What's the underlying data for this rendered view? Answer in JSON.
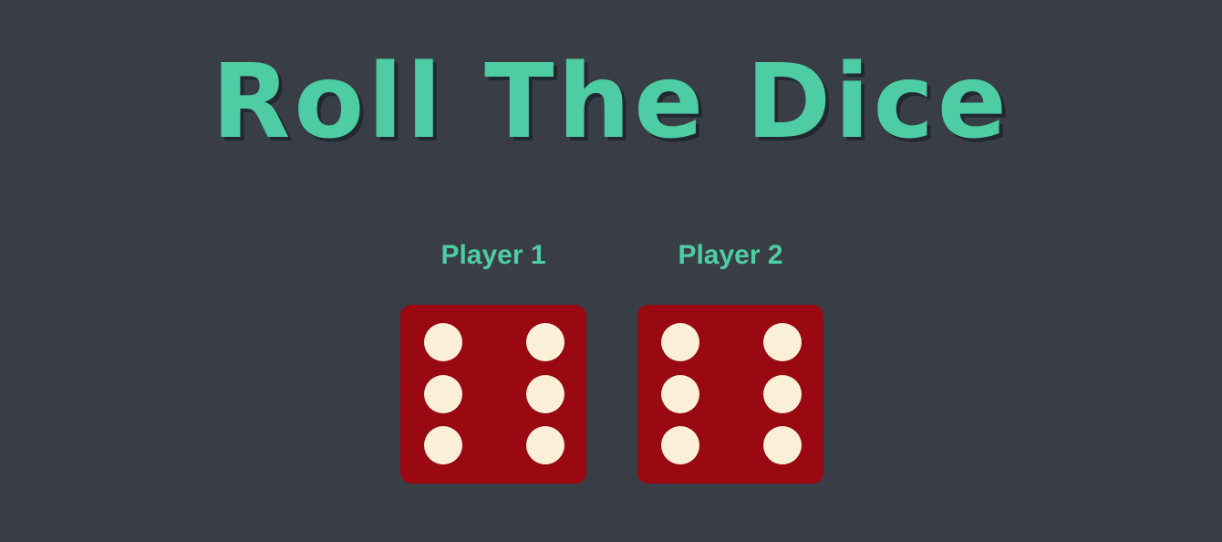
{
  "title": "Roll The Dice",
  "colors": {
    "background": "#393e46",
    "accent": "#4ecca3",
    "title_shadow": "#222831",
    "die": "#9a0811",
    "pip": "#fbf0d7"
  },
  "players": [
    {
      "label": "Player 1",
      "die_value": 6
    },
    {
      "label": "Player 2",
      "die_value": 6
    }
  ]
}
